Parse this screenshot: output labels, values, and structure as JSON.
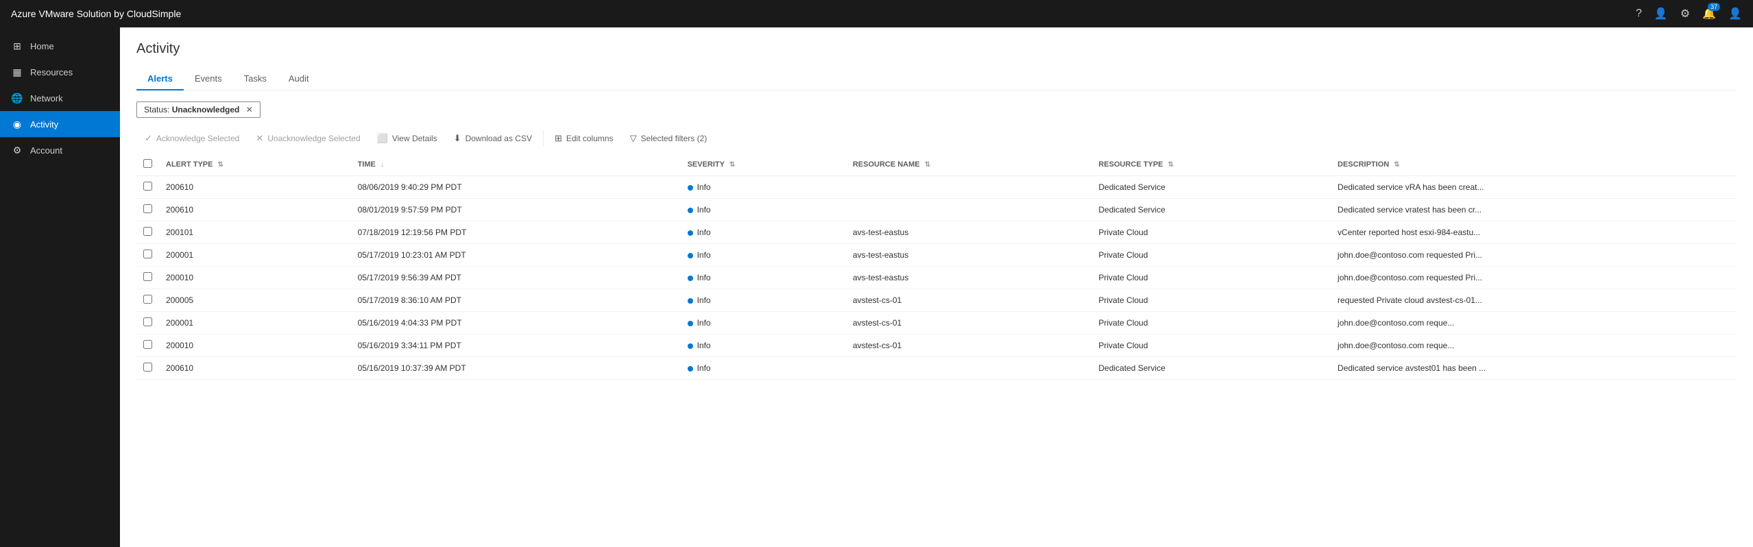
{
  "app": {
    "title": "Azure VMware Solution by CloudSimple"
  },
  "topbar": {
    "title": "Azure VMware Solution by CloudSimple",
    "icons": [
      "help-icon",
      "user-circle-icon",
      "settings-icon",
      "bell-icon",
      "account-icon"
    ],
    "notification_count": "37"
  },
  "sidebar": {
    "items": [
      {
        "id": "home",
        "label": "Home",
        "icon": "⊞",
        "active": false
      },
      {
        "id": "resources",
        "label": "Resources",
        "icon": "⊟",
        "active": false
      },
      {
        "id": "network",
        "label": "Network",
        "icon": "🌐",
        "active": false
      },
      {
        "id": "activity",
        "label": "Activity",
        "icon": "◉",
        "active": true
      },
      {
        "id": "account",
        "label": "Account",
        "icon": "⚙",
        "active": false
      }
    ]
  },
  "page": {
    "title": "Activity"
  },
  "tabs": [
    {
      "id": "alerts",
      "label": "Alerts",
      "active": true
    },
    {
      "id": "events",
      "label": "Events",
      "active": false
    },
    {
      "id": "tasks",
      "label": "Tasks",
      "active": false
    },
    {
      "id": "audit",
      "label": "Audit",
      "active": false
    }
  ],
  "filter": {
    "status_label": "Status:",
    "status_value": "Unacknowledged"
  },
  "toolbar": {
    "acknowledge_selected": "Acknowledge Selected",
    "unacknowledge_selected": "Unacknowledge Selected",
    "view_details": "View Details",
    "download_csv": "Download as CSV",
    "edit_columns": "Edit columns",
    "selected_filters": "Selected filters (2)"
  },
  "table": {
    "columns": [
      {
        "id": "alert_type",
        "label": "ALERT TYPE"
      },
      {
        "id": "time",
        "label": "TIME"
      },
      {
        "id": "severity",
        "label": "SEVERITY"
      },
      {
        "id": "resource_name",
        "label": "RESOURCE NAME"
      },
      {
        "id": "resource_type",
        "label": "RESOURCE TYPE"
      },
      {
        "id": "description",
        "label": "DESCRIPTION"
      }
    ],
    "rows": [
      {
        "alert_type": "200610",
        "time": "08/06/2019 9:40:29 PM PDT",
        "severity": "Info",
        "resource_name": "",
        "resource_type": "Dedicated Service",
        "description": "Dedicated service vRA has been creat..."
      },
      {
        "alert_type": "200610",
        "time": "08/01/2019 9:57:59 PM PDT",
        "severity": "Info",
        "resource_name": "",
        "resource_type": "Dedicated Service",
        "description": "Dedicated service vratest has been cr..."
      },
      {
        "alert_type": "200101",
        "time": "07/18/2019 12:19:56 PM PDT",
        "severity": "Info",
        "resource_name": "avs-test-eastus",
        "resource_type": "Private Cloud",
        "description": "vCenter reported host esxi-984-eastu..."
      },
      {
        "alert_type": "200001",
        "time": "05/17/2019 10:23:01 AM PDT",
        "severity": "Info",
        "resource_name": "avs-test-eastus",
        "resource_type": "Private Cloud",
        "description": "john.doe@contoso.com  requested Pri..."
      },
      {
        "alert_type": "200010",
        "time": "05/17/2019 9:56:39 AM PDT",
        "severity": "Info",
        "resource_name": "avs-test-eastus",
        "resource_type": "Private Cloud",
        "description": "john.doe@contoso.com  requested Pri..."
      },
      {
        "alert_type": "200005",
        "time": "05/17/2019 8:36:10 AM PDT",
        "severity": "Info",
        "resource_name": "avstest-cs-01",
        "resource_type": "Private Cloud",
        "description": "requested Private cloud avstest-cs-01..."
      },
      {
        "alert_type": "200001",
        "time": "05/16/2019 4:04:33 PM PDT",
        "severity": "Info",
        "resource_name": "avstest-cs-01",
        "resource_type": "Private Cloud",
        "description": "john.doe@contoso.com    reque..."
      },
      {
        "alert_type": "200010",
        "time": "05/16/2019 3:34:11 PM PDT",
        "severity": "Info",
        "resource_name": "avstest-cs-01",
        "resource_type": "Private Cloud",
        "description": "john.doe@contoso.com    reque..."
      },
      {
        "alert_type": "200610",
        "time": "05/16/2019 10:37:39 AM PDT",
        "severity": "Info",
        "resource_name": "",
        "resource_type": "Dedicated Service",
        "description": "Dedicated service avstest01 has been ..."
      }
    ]
  }
}
